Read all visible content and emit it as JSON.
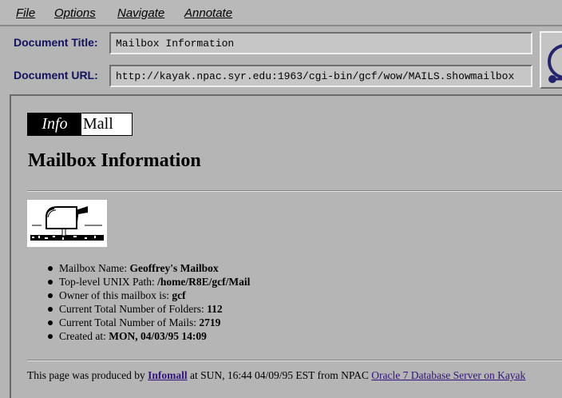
{
  "menubar": {
    "items": [
      {
        "label": "File"
      },
      {
        "label": "Options"
      },
      {
        "label": "Navigate"
      },
      {
        "label": "Annotate"
      }
    ]
  },
  "document": {
    "title_label": "Document Title:",
    "title_value": "Mailbox Information",
    "url_label": "Document URL:",
    "url_value": "http://kayak.npac.syr.edu:1963/cgi-bin/gcf/wow/MAILS.showmailbox"
  },
  "page": {
    "logo_info": "Info",
    "logo_mall": "Mall",
    "heading": "Mailbox Information",
    "details": [
      {
        "label": "Mailbox Name: ",
        "value": "Geoffrey's Mailbox"
      },
      {
        "label": "Top-level UNIX Path: ",
        "value": "/home/R8E/gcf/Mail"
      },
      {
        "label": "Owner of this mailbox is: ",
        "value": "gcf"
      },
      {
        "label": "Current Total Number of Folders: ",
        "value": "112"
      },
      {
        "label": "Current Total Number of Mails: ",
        "value": "2719"
      },
      {
        "label": "Created at: ",
        "value": "MON, 04/03/95 14:09"
      }
    ],
    "footer": {
      "prefix": "This page was produced by ",
      "link1": "Infomall",
      "middle": " at SUN, 16:44 04/09/95 EST from NPAC ",
      "link2": "Oracle 7 Database Server on Kayak"
    }
  }
}
